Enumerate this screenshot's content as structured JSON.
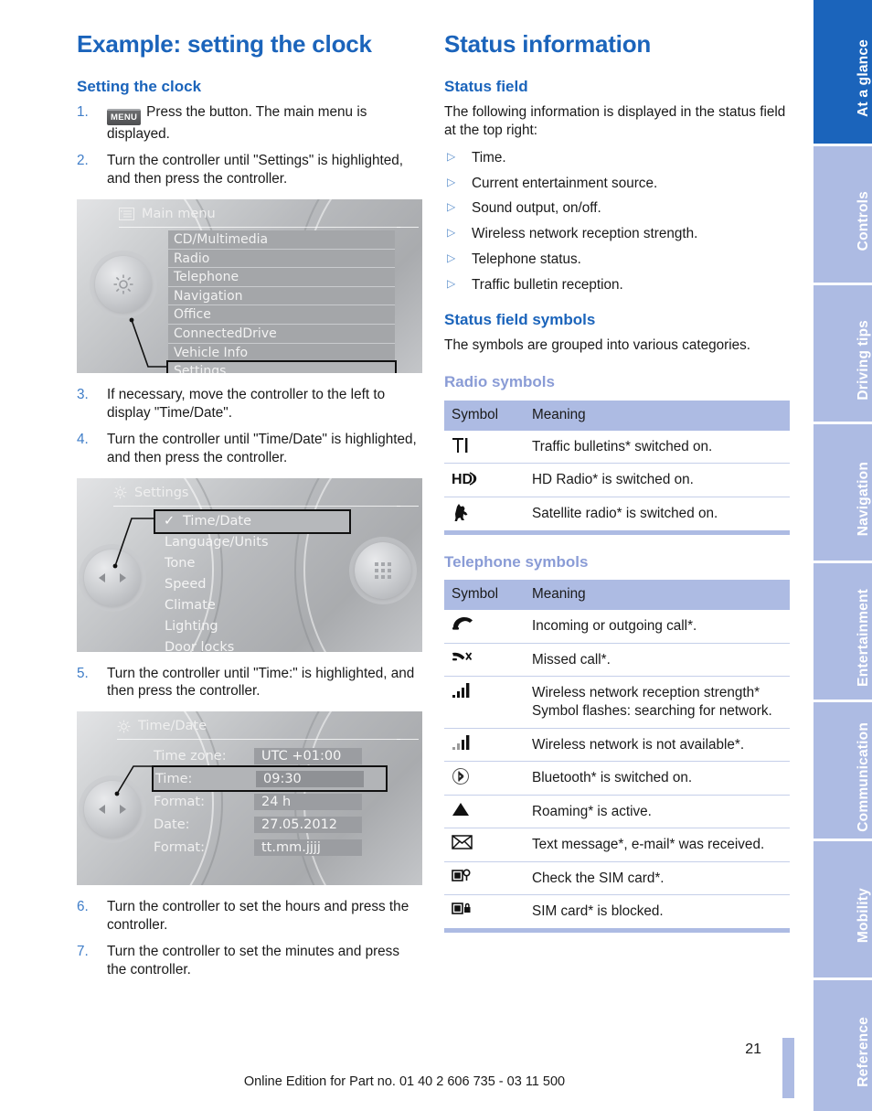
{
  "left": {
    "chapter_title": "Example: setting the clock",
    "section_title": "Setting the clock",
    "steps": [
      {
        "num": "1.",
        "icon": "menu-key",
        "icon_label": "MENU",
        "text": "Press the button. The main menu is displayed."
      },
      {
        "num": "2.",
        "text": "Turn the controller until \"Settings\" is highlighted, and then press the controller."
      },
      {
        "num": "3.",
        "text": "If necessary, move the controller to the left to display \"Time/Date\"."
      },
      {
        "num": "4.",
        "text": "Turn the controller until \"Time/Date\" is highlighted, and then press the controller."
      },
      {
        "num": "5.",
        "text": "Turn the controller until \"Time:\" is highlighted, and then press the controller."
      },
      {
        "num": "6.",
        "text": "Turn the controller to set the hours and press the controller."
      },
      {
        "num": "7.",
        "text": "Turn the controller to set the minutes and press the controller."
      }
    ],
    "screen_main_menu": {
      "title": "Main menu",
      "title_icon": "list-icon",
      "knob_icon": "gear-icon",
      "items": [
        {
          "label": "CD/Multimedia",
          "selected": false
        },
        {
          "label": "Radio",
          "selected": false
        },
        {
          "label": "Telephone",
          "selected": false
        },
        {
          "label": "Navigation",
          "selected": false
        },
        {
          "label": "Office",
          "selected": false
        },
        {
          "label": "ConnectedDrive",
          "selected": false
        },
        {
          "label": "Vehicle Info",
          "selected": false
        },
        {
          "label": "Settings",
          "selected": true
        }
      ]
    },
    "screen_settings": {
      "title": "Settings",
      "title_icon": "gear-icon",
      "left_knob_icon": "left-right-arrows-icon",
      "right_knob_icon": "keypad-icon",
      "items": [
        {
          "label": "Time/Date",
          "selected": true,
          "check": "✓"
        },
        {
          "label": "Language/Units",
          "selected": false
        },
        {
          "label": "Tone",
          "selected": false
        },
        {
          "label": "Speed",
          "selected": false
        },
        {
          "label": "Climate",
          "selected": false
        },
        {
          "label": "Lighting",
          "selected": false
        },
        {
          "label": "Door locks",
          "selected": false
        }
      ]
    },
    "screen_time_date": {
      "title": "Time/Date",
      "title_icon": "gear-icon",
      "left_knob_icon": "left-right-arrows-icon",
      "rows": [
        {
          "label": "Time zone:",
          "value": "UTC +01:00",
          "selected": false
        },
        {
          "label": "Time:",
          "value": "09:30",
          "selected": true
        },
        {
          "label": "Format:",
          "value": "24 h",
          "selected": false
        },
        {
          "label": "Date:",
          "value": "27.05.2012",
          "selected": false
        },
        {
          "label": "Format:",
          "value": "tt.mm.jjjj",
          "selected": false
        }
      ]
    }
  },
  "right": {
    "chapter_title": "Status information",
    "status_field": {
      "heading": "Status field",
      "intro": "The following information is displayed in the status field at the top right:",
      "items": [
        "Time.",
        "Current entertainment source.",
        "Sound output, on/off.",
        "Wireless network reception strength.",
        "Telephone status.",
        "Traffic bulletin reception."
      ]
    },
    "status_field_symbols": {
      "heading": "Status field symbols",
      "intro": "The symbols are grouped into various categories."
    },
    "radio_symbols": {
      "heading": "Radio symbols",
      "columns": [
        "Symbol",
        "Meaning"
      ],
      "rows": [
        {
          "symbol": "traffic-bulletin-ti-icon",
          "glyph": "TI",
          "meaning": "Traffic bulletins* switched on."
        },
        {
          "symbol": "hd-radio-icon",
          "glyph": "HD",
          "meaning": "HD Radio* is switched on."
        },
        {
          "symbol": "satellite-radio-dog-icon",
          "glyph": "",
          "meaning": "Satellite radio* is switched on."
        }
      ]
    },
    "telephone_symbols": {
      "heading": "Telephone symbols",
      "columns": [
        "Symbol",
        "Meaning"
      ],
      "rows": [
        {
          "symbol": "handset-call-icon",
          "meaning": "Incoming or outgoing call*."
        },
        {
          "symbol": "missed-call-icon",
          "meaning": "Missed call*."
        },
        {
          "symbol": "signal-bars-full-icon",
          "meaning": "Wireless network reception strength* Symbol flashes: searching for network."
        },
        {
          "symbol": "signal-bars-unavailable-icon",
          "meaning": "Wireless network is not available*."
        },
        {
          "symbol": "bluetooth-icon",
          "meaning": "Bluetooth* is switched on."
        },
        {
          "symbol": "roaming-triangle-icon",
          "meaning": "Roaming* is active."
        },
        {
          "symbol": "envelope-icon",
          "meaning": "Text message*, e-mail* was received."
        },
        {
          "symbol": "sim-check-icon",
          "meaning": "Check the SIM card*."
        },
        {
          "symbol": "sim-blocked-icon",
          "meaning": "SIM card* is blocked."
        }
      ]
    }
  },
  "tabs": [
    {
      "label": "At a glance",
      "active": true
    },
    {
      "label": "Controls",
      "active": false
    },
    {
      "label": "Driving tips",
      "active": false
    },
    {
      "label": "Navigation",
      "active": false
    },
    {
      "label": "Entertainment",
      "active": false
    },
    {
      "label": "Communication",
      "active": false
    },
    {
      "label": "Mobility",
      "active": false
    },
    {
      "label": "Reference",
      "active": false
    }
  ],
  "footer": {
    "page_number": "21",
    "edition": "Online Edition for Part no. 01 40 2 606 735 - 03 11 500"
  },
  "colors": {
    "heading_blue": "#1b64bb",
    "subheading_blue": "#8a9cd6",
    "table_header": "#adbbe3",
    "tab_active": "#1b64bb",
    "tab_inactive": "#adbbe3",
    "step_number": "#3f7dc8"
  }
}
